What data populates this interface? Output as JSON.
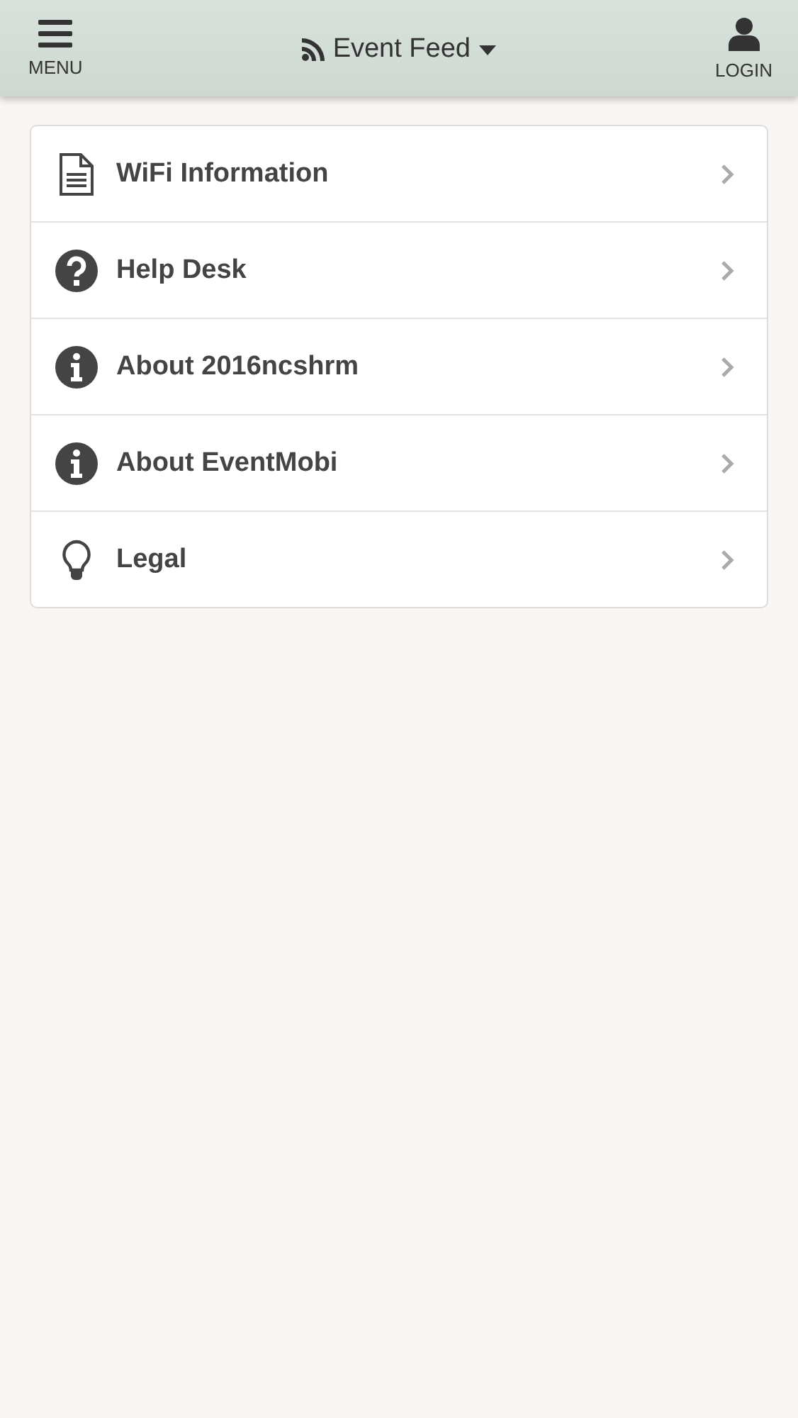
{
  "header": {
    "menu_label": "MENU",
    "title": "Event Feed",
    "login_label": "LOGIN"
  },
  "items": [
    {
      "label": "WiFi Information",
      "kind": "document"
    },
    {
      "label": "Help Desk",
      "kind": "question"
    },
    {
      "label": "About 2016ncshrm",
      "kind": "info"
    },
    {
      "label": "About EventMobi",
      "kind": "info"
    },
    {
      "label": "Legal",
      "kind": "bulb"
    }
  ]
}
